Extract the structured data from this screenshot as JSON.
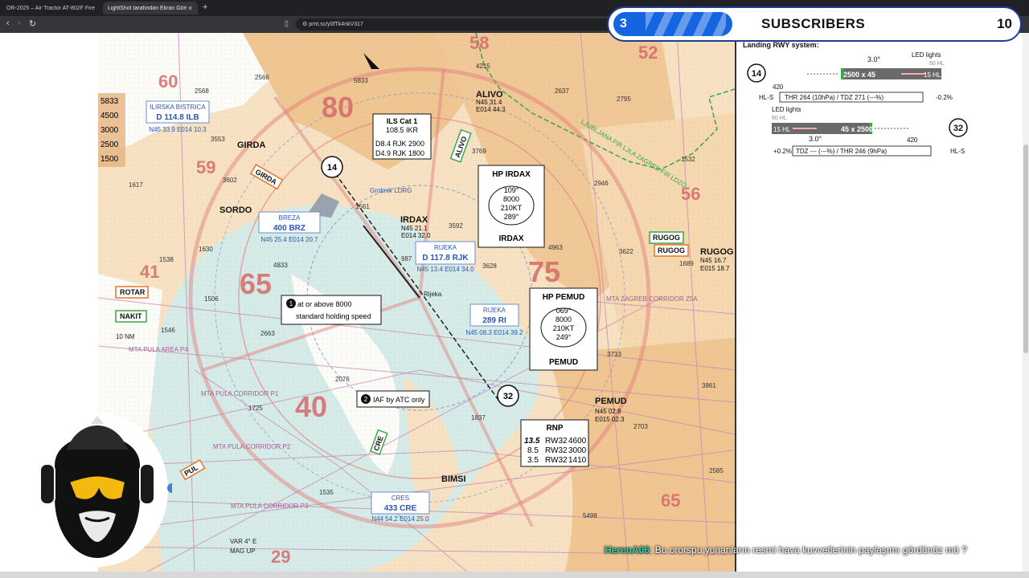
{
  "browser": {
    "tabs": [
      {
        "label": "OR-2025 – Air Tractor AT-802F Fire Fi"
      },
      {
        "label": "LightShot tarafından Ekran Görü"
      }
    ],
    "url": "prnt.sc/y0fTk4nkV317"
  },
  "overlay": {
    "subscriber_count": "3",
    "subscriber_label": "SUBSCRIBERS",
    "subscriber_goal": "10"
  },
  "chat": {
    "username": "HerenA06",
    "message": ": Bu ororspu yunanların resmi hava kuvvetlerinin paylaşımı gördünüz mü ?"
  },
  "chart": {
    "ils_box": {
      "title": "ILS Cat 1",
      "freq": "108.5 IKR",
      "line1": "D8.4  RJK  2900",
      "line2": "D4.9  RJK  1800"
    },
    "hp_irdax": {
      "title": "HP IRDAX",
      "crs_in": "109°",
      "alt": "8000",
      "spd": "210KT",
      "crs_out": "289°",
      "fix": "IRDAX"
    },
    "hp_pemud": {
      "title": "HP PEMUD",
      "crs_in": "069°",
      "alt": "8000",
      "spd": "210KT",
      "crs_out": "249°",
      "fix": "PEMUD"
    },
    "holding_note": {
      "num": "1",
      "text1": "at or above 8000",
      "text2": "standard holding speed"
    },
    "iaf_atc": {
      "num": "2",
      "text": "IAF by ATC only"
    },
    "rnp": {
      "title": "RNP",
      "rows": [
        {
          "d": "13.5",
          "rw": "RW32",
          "alt": "4600"
        },
        {
          "d": "8.5",
          "rw": "RW32",
          "alt": "3000"
        },
        {
          "d": "3.5",
          "rw": "RW32",
          "alt": "1410"
        }
      ]
    },
    "navaids": {
      "ilb": {
        "name": "ILIRSKA BISTRICA",
        "freq": "D 114.8 ILB",
        "coord": "N45 33.9 E014 10.3"
      },
      "brz": {
        "name": "BREZA",
        "freq": "400 BRZ",
        "coord": "N45 25.4 E014 20.7"
      },
      "rjk": {
        "name": "RIJEKA",
        "freq": "D 117.8 RJK",
        "coord": "N45 13.4 E014 34.0"
      },
      "ri": {
        "name": "RIJEKA",
        "freq": "289 RI",
        "coord": "N45 08.3 E014 39.2"
      },
      "cre": {
        "name": "CRES",
        "freq": "433 CRE",
        "coord": "N44 54.2 E014 25.0"
      }
    },
    "fixes": {
      "girda": "GIRDA",
      "sordo": "SORDO",
      "irdax": "IRDAX",
      "alivo": "ALIVO",
      "rugog": "RUGOG",
      "pemud": "PEMUD",
      "bimsi": "BIMSI",
      "alivo_coord1": "N45 31.4",
      "alivo_coord2": "E014 44.3",
      "irdax_coord1": "N45 21.1",
      "irdax_coord2": "E014 32.0",
      "rugog_coord1": "N45 16.7",
      "rugog_coord2": "E015 18.7",
      "pemud_coord1": "N45 02.8",
      "pemud_coord2": "E015 02.3"
    },
    "route_tags": [
      "ROTAR",
      "NAKIT",
      "RUGOG",
      "GIRDA",
      "ALIVO",
      "CRE",
      "PUL"
    ],
    "rwy_circles": [
      "14",
      "32"
    ],
    "msa_values": [
      "80",
      "75",
      "65",
      "59",
      "58",
      "56",
      "52",
      "41",
      "40",
      "29",
      "60",
      "65"
    ],
    "sector_alts": [
      "5833",
      "4500",
      "3000",
      "2500",
      "1500"
    ],
    "labels": {
      "mta_pula_p4": "MTA PULA AREA P4",
      "mta_pula_p1": "MTA PULA CORRIDOR P1",
      "mta_pula_p2": "MTA PULA CORRIDOR P2",
      "mta_pula_p3": "MTA PULA CORRIDOR P3",
      "mta_zagreb": "MTA ZAGREB CORRIDOR Z5A",
      "ten_nm": "10 NM",
      "var": "VAR 4° E",
      "mag_up": "MAG UP",
      "fir": "LJUBLJANA FIR LJLA ZAGREB FIR LDZO",
      "rijeka": "Rijeka",
      "grobnik": "Grobnik LDRG"
    },
    "elevations": [
      "2568",
      "2566",
      "5833",
      "4215",
      "2637",
      "2795",
      "3602",
      "3553",
      "3769",
      "1561",
      "3592",
      "1630",
      "4833",
      "987",
      "4963",
      "3628",
      "3622",
      "1689",
      "1538",
      "1506",
      "2663",
      "1546",
      "3733",
      "3861",
      "2076",
      "1725",
      "1837",
      "2703",
      "1535",
      "5498",
      "1532",
      "2946",
      "1617",
      "2585"
    ]
  },
  "right_panel": {
    "title": "Landing RWY system:",
    "led_lights": "LED lights",
    "led_lights2": "LED lights",
    "hl_60": "60 HL",
    "hl_60b": "60 HL",
    "hl_15": "15 HL",
    "hl_15b": "15 HL",
    "glide1": "3.0°",
    "glide2": "3.0°",
    "rwy14": "14",
    "rwy32": "32",
    "dist420a": "420",
    "dist420b": "420",
    "rwy_dims1": "2500 x 45",
    "rwy_dims2": "45 x 2500",
    "hls1": "HL-S",
    "hls2": "HL-S",
    "thr14": "THR 264 (10hPa) / TDZ 271 (---%)",
    "thr14_grad": "-0.2%",
    "thr32": "TDZ --- (---%) / THR 246 (9hPa)",
    "thr32_grad": "+0.2%"
  },
  "colors": {
    "terrain": "#f1cfa3",
    "terrain_dark": "#e7b37e",
    "water": "#d5ebe8",
    "msa_red": "#e37b7b",
    "airspace": "#c98ab8",
    "blue_text": "#2a56b8",
    "fir_green": "#2fa84b",
    "tag_orange": "#e8762a",
    "tag_green": "#3aa64a",
    "subscriber_blue": "#1565e0"
  }
}
